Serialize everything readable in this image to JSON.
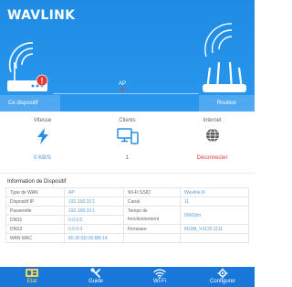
{
  "hero": {
    "logo": "WAVLINK",
    "ap_label": "AP",
    "ap_status_mark": "✕",
    "device_label": "Ce dispositif",
    "router_label": "Routeur",
    "alert_mark": "!"
  },
  "stats": {
    "speed": {
      "title": "Vitesse",
      "value": "0 KB/S",
      "icon": "lightning-icon"
    },
    "clients": {
      "title": "Clients",
      "value": "1",
      "icon": "devices-icon"
    },
    "internet": {
      "title": "Internet",
      "value": "Déconnecter",
      "icon": "globe-icon"
    }
  },
  "info": {
    "title": "Information de Dispositif",
    "wan_type_label": "Type de WAN",
    "wan_type": "AP",
    "ip_label": "Dispositif IP",
    "ip": "192.168.10.1",
    "gateway_label": "Passerelle",
    "gateway": "192.168.10.1",
    "dns1_label": "DNS1",
    "dns1": "0.0.0.0",
    "dns2_label": "DNS2",
    "dns2": "0.0.0.0",
    "mac_label": "WAN MAC",
    "mac": "80:3F:5D:65:BB:14",
    "ssid_label": "Wi-Fi SSID",
    "ssid": "Wavlink-N",
    "channel_label": "Canal",
    "channel": "11",
    "uptime_label": "Temps de fonctionnement",
    "uptime": "00h59m",
    "firmware_label": "Firmware",
    "firmware": "M18N_V3130.1111"
  },
  "nav": {
    "etat": "Etat",
    "guide": "Guide",
    "wifi": "Wi-Fi",
    "configurer": "Configurer"
  },
  "colors": {
    "primary": "#1f8be4",
    "nav": "#1877d8",
    "accent": "#ffd44a",
    "error": "#e53935",
    "link": "#5b9de0"
  }
}
